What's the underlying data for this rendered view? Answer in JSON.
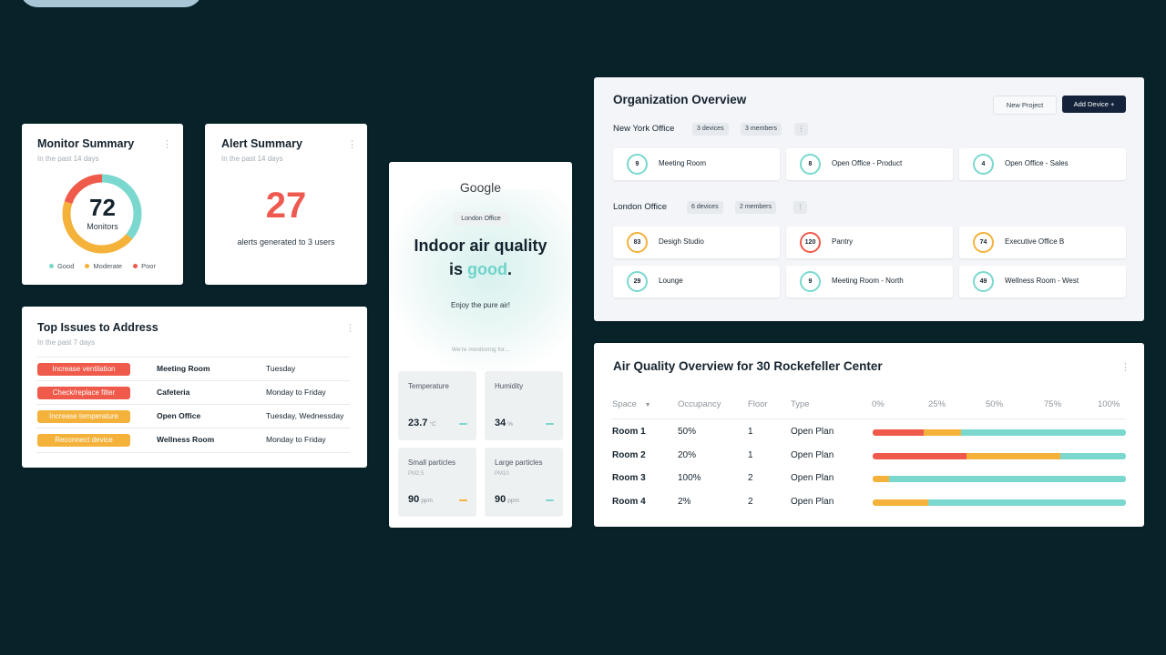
{
  "colors": {
    "good": "#7ad8cf",
    "moderate": "#f4b23a",
    "poor": "#ef5a4a",
    "background": "#08222a",
    "dark_button": "#14233a"
  },
  "monitor_summary": {
    "title": "Monitor Summary",
    "subtitle": "In the past 14 days",
    "count": "72",
    "count_label": "Monitors",
    "legend": [
      "Good",
      "Moderate",
      "Poor"
    ],
    "segments": {
      "good": 0.36,
      "moderate": 0.44,
      "poor": 0.2
    }
  },
  "alert_summary": {
    "title": "Alert Summary",
    "subtitle": "In the past 14 days",
    "count": "27",
    "text": "alerts generated to 3 users"
  },
  "top_issues": {
    "title": "Top Issues to Address",
    "subtitle": "In the past 7 days",
    "rows": [
      {
        "issue": "Increase ventilation",
        "room": "Meeting Room",
        "when": "Tuesday",
        "severity": "poor"
      },
      {
        "issue": "Check/replace filter",
        "room": "Cafeteria",
        "when": "Monday to Friday",
        "severity": "poor"
      },
      {
        "issue": "Increase temperature",
        "room": "Open Office",
        "when": "Tuesday, Wednessday",
        "severity": "moderate"
      },
      {
        "issue": "Reconnect device",
        "room": "Wellness Room",
        "when": "Monday to Friday",
        "severity": "moderate"
      }
    ]
  },
  "phone": {
    "logo": "Google",
    "office": "London Office",
    "headline_1": "Indoor air quality",
    "headline_2_prefix": "is ",
    "headline_2_word": "good",
    "headline_2_suffix": ".",
    "enjoy": "Enjoy the pure air!",
    "monitoring": "We're monitoring for...",
    "metrics": [
      {
        "label": "Temperature",
        "sub": "",
        "value": "23.7",
        "unit": "°C",
        "status": "good"
      },
      {
        "label": "Humidity",
        "sub": "",
        "value": "34",
        "unit": "%",
        "status": "good"
      },
      {
        "label": "Small particles",
        "sub": "PM2.5",
        "value": "90",
        "unit": "ppm",
        "status": "moderate"
      },
      {
        "label": "Large particles",
        "sub": "PM10",
        "value": "90",
        "unit": "ppm",
        "status": "good"
      }
    ]
  },
  "org": {
    "title": "Organization Overview",
    "new_project": "New Project",
    "add_device": "Add Device +",
    "offices": [
      {
        "name": "New York Office",
        "devices": "3 devices",
        "members": "3 members",
        "rooms": [
          {
            "score": "9",
            "name": "Meeting Room",
            "status": "good"
          },
          {
            "score": "8",
            "name": "Open Office - Product",
            "status": "good"
          },
          {
            "score": "4",
            "name": "Open Office - Sales",
            "status": "good"
          }
        ]
      },
      {
        "name": "London Office",
        "devices": "6 devices",
        "members": "2 members",
        "rooms": [
          {
            "score": "83",
            "name": "Desigh Studio",
            "status": "moderate"
          },
          {
            "score": "120",
            "name": "Pantry",
            "status": "poor"
          },
          {
            "score": "74",
            "name": "Executive Office B",
            "status": "moderate"
          },
          {
            "score": "29",
            "name": "Lounge",
            "status": "good"
          },
          {
            "score": "9",
            "name": "Meeting Room - North",
            "status": "good"
          },
          {
            "score": "49",
            "name": "Wellness Room - West",
            "status": "good"
          }
        ]
      }
    ]
  },
  "aq_overview": {
    "title": "Air Quality Overview for 30 Rockefeller Center",
    "headers": {
      "space": "Space",
      "occupancy": "Occupancy",
      "floor": "Floor",
      "type": "Type"
    },
    "scale": [
      "0%",
      "25%",
      "50%",
      "75%",
      "100%"
    ],
    "rows": [
      {
        "space": "Room 1",
        "occupancy": "50%",
        "floor": "1",
        "type": "Open Plan",
        "poor": 0.2,
        "moderate": 0.15,
        "good": 0.65
      },
      {
        "space": "Room 2",
        "occupancy": "20%",
        "floor": "1",
        "type": "Open Plan",
        "poor": 0.37,
        "moderate": 0.37,
        "good": 0.26
      },
      {
        "space": "Room 3",
        "occupancy": "100%",
        "floor": "2",
        "type": "Open Plan",
        "poor": 0.0,
        "moderate": 0.065,
        "good": 0.935
      },
      {
        "space": "Room 4",
        "occupancy": "2%",
        "floor": "2",
        "type": "Open Plan",
        "poor": 0.0,
        "moderate": 0.22,
        "good": 0.78
      }
    ]
  }
}
